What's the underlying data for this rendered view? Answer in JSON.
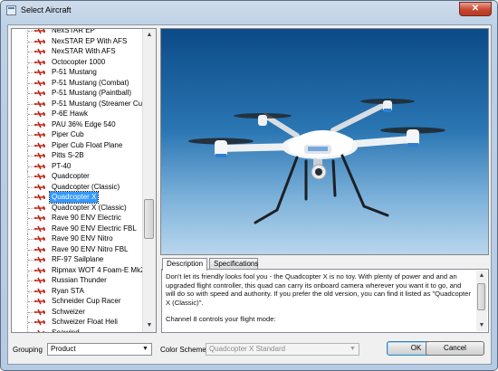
{
  "window": {
    "title": "Select Aircraft",
    "close_label": "✕"
  },
  "aircraft_list": {
    "items": [
      "NexSTAR EP",
      "NexSTAR EP With AFS",
      "NexSTAR With AFS",
      "Octocopter 1000",
      "P-51 Mustang",
      "P-51 Mustang (Combat)",
      "P-51 Mustang (Paintball)",
      "P-51 Mustang (Streamer Cut)",
      "P-6E Hawk",
      "PAU 36% Edge 540",
      "Piper Cub",
      "Piper Cub Float Plane",
      "Pitts S-2B",
      "PT-40",
      "Quadcopter",
      "Quadcopter (Classic)",
      "Quadcopter X",
      "Quadcopter X (Classic)",
      "Rave 90 ENV Electric",
      "Rave 90 ENV Electric FBL",
      "Rave 90 ENV Nitro",
      "Rave 90 ENV Nitro FBL",
      "RF-97 Sailplane",
      "Ripmax WOT 4 Foam-E Mk2",
      "Russian Thunder",
      "Ryan STA",
      "Schneider Cup Racer",
      "Schweizer",
      "Schweizer Float Heli",
      "Seawind"
    ],
    "selected_index": 16,
    "scroll_up": "▲",
    "scroll_down": "▼",
    "icon": "red-airplane-icon"
  },
  "tabs": [
    {
      "label": "Description",
      "active": true
    },
    {
      "label": "Specifications",
      "active": false
    }
  ],
  "description": {
    "paragraphs": [
      "Don't let its friendly looks fool you - the Quadcopter X is no toy.  With plenty of power and and an upgraded flight controller, this quad can carry its onboard camera wherever you want it to go, and will do so with speed and authority. If you prefer the old version, you can find it listed as \"Quadcopter X (Classic)\".",
      "Channel 8 controls your flight mode:"
    ],
    "scroll_up": "▲",
    "scroll_down": "▼"
  },
  "grouping": {
    "label": "Grouping",
    "value": "Product",
    "arrow": "▼"
  },
  "color_scheme": {
    "label": "Color Scheme",
    "value": "Quadcopter X Standard",
    "arrow": "▼",
    "enabled": false
  },
  "buttons": {
    "ok": "OK",
    "cancel": "Cancel"
  },
  "colors": {
    "list_icon": "#c0281a",
    "selection": "#3399ff",
    "sky_top": "#0b4b87",
    "sky_bottom": "#b9d6ec",
    "drone_body": "#f2f4f6",
    "drone_accent": "#2f7fd0"
  }
}
